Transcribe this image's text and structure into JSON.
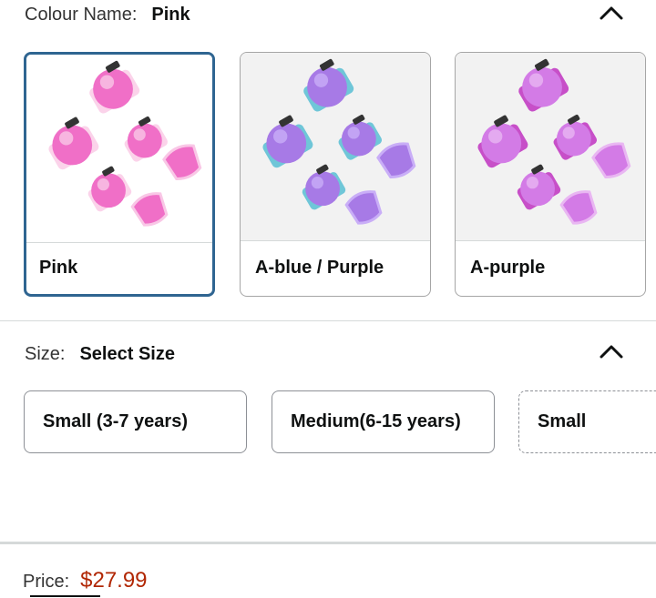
{
  "colour": {
    "key_label": "Colour Name:",
    "selected_value": "Pink",
    "collapse_icon": "chevron-up-icon",
    "options": [
      {
        "label": "Pink",
        "selected": true,
        "main": "#f06fc7",
        "light": "#f9c7e6",
        "band": "#fbd3ea"
      },
      {
        "label": "A-blue / Purple",
        "selected": false,
        "main": "#a77ae6",
        "light": "#c9aef7",
        "band": "#6fc6d8"
      },
      {
        "label": "A-purple",
        "selected": false,
        "main": "#d37be6",
        "light": "#e9b7f2",
        "band": "#c74fc8"
      }
    ]
  },
  "size": {
    "key_label": "Size:",
    "selected_value": "Select Size",
    "collapse_icon": "chevron-up-icon",
    "options": [
      {
        "label": "Small (3-7 years)"
      },
      {
        "label": "Medium(6-15 years)"
      },
      {
        "label": "Small"
      }
    ]
  },
  "price": {
    "key_label": "Price:",
    "value": "$27.99"
  },
  "colors": {
    "selected_border": "#2f6591",
    "price_red": "#b12704"
  }
}
